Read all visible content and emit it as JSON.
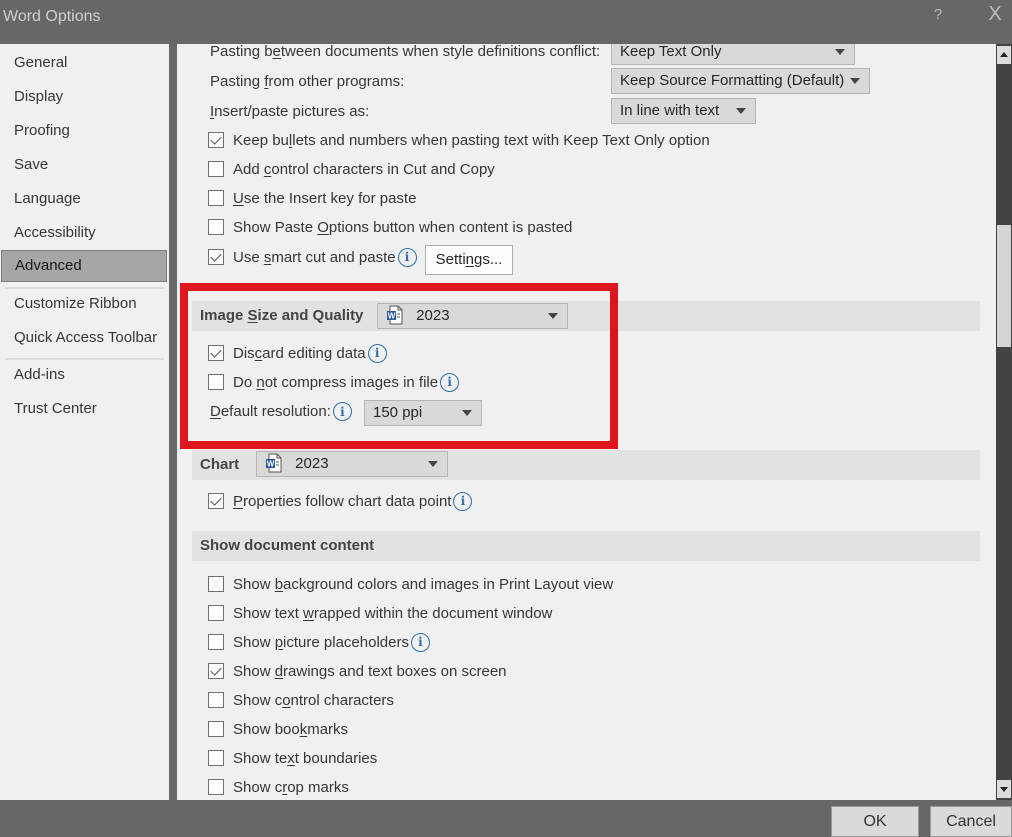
{
  "window": {
    "title": "Word Options",
    "help_label": "?",
    "close_label": "X"
  },
  "sidebar": {
    "items": [
      {
        "label": "General",
        "active": false
      },
      {
        "label": "Display",
        "active": false
      },
      {
        "label": "Proofing",
        "active": false
      },
      {
        "label": "Save",
        "active": false
      },
      {
        "label": "Language",
        "active": false
      },
      {
        "label": "Accessibility",
        "active": false
      },
      {
        "label": "Advanced",
        "active": true
      },
      {
        "label": "Customize Ribbon",
        "active": false
      },
      {
        "label": "Quick Access Toolbar",
        "active": false
      },
      {
        "label": "Add-ins",
        "active": false
      },
      {
        "label": "Trust Center",
        "active": false
      }
    ]
  },
  "paste": {
    "between_docs": {
      "label_pre": "Pasting b",
      "label_u": "e",
      "label_post": "tween documents when style definitions conflict:",
      "value": "Keep Text Only"
    },
    "other_programs": {
      "label_pre": "Pasting ",
      "label_u": "f",
      "label_post": "rom other programs:",
      "value": "Keep Source Formatting (Default)"
    },
    "pictures": {
      "label_pre": "",
      "label_u": "I",
      "label_post": "nsert/paste pictures as:",
      "value": "In line with text"
    },
    "options": [
      {
        "pre": "Keep bu",
        "u": "l",
        "post": "lets and numbers when pasting text with Keep Text Only option",
        "checked": true
      },
      {
        "pre": "Add ",
        "u": "c",
        "post": "ontrol characters in Cut and Copy",
        "checked": false
      },
      {
        "pre": "",
        "u": "U",
        "post": "se the Insert key for paste",
        "checked": false
      },
      {
        "pre": "Show Paste ",
        "u": "O",
        "post": "ptions button when content is pasted",
        "checked": false
      },
      {
        "pre": "Use ",
        "u": "s",
        "post": "mart cut and paste",
        "checked": true
      }
    ],
    "settings_button": {
      "pre": "Setti",
      "u": "n",
      "post": "gs..."
    }
  },
  "image_size": {
    "title_pre": "Image ",
    "title_u": "S",
    "title_post": "ize and Quality",
    "document": "2023",
    "options": [
      {
        "pre": "Dis",
        "u": "c",
        "post": "ard editing data",
        "checked": true
      },
      {
        "pre": "Do ",
        "u": "n",
        "post": "ot compress images in file",
        "checked": false
      }
    ],
    "resolution_label_u": "D",
    "resolution_label_post": "efault resolution:",
    "resolution_value": "150 ppi"
  },
  "chart": {
    "title": "Chart",
    "document": "2023",
    "options": [
      {
        "pre": "",
        "u": "P",
        "post": "roperties follow chart data point",
        "checked": true
      }
    ]
  },
  "show_content": {
    "title": "Show document content",
    "options": [
      {
        "pre": "Show ",
        "u": "b",
        "post": "ackground colors and images in Print Layout view",
        "checked": false
      },
      {
        "pre": "Show text ",
        "u": "w",
        "post": "rapped within the document window",
        "checked": false
      },
      {
        "pre": "Show ",
        "u": "p",
        "post": "icture placeholders",
        "checked": false
      },
      {
        "pre": "Show ",
        "u": "d",
        "post": "rawings and text boxes on screen",
        "checked": true
      },
      {
        "pre": "Show c",
        "u": "o",
        "post": "ntrol characters",
        "checked": false
      },
      {
        "pre": "Show boo",
        "u": "k",
        "post": "marks",
        "checked": false
      },
      {
        "pre": "Show te",
        "u": "x",
        "post": "t boundaries",
        "checked": false
      },
      {
        "pre": "Show c",
        "u": "r",
        "post": "op marks",
        "checked": false
      }
    ]
  },
  "footer": {
    "ok_label": "OK",
    "cancel_label": "Cancel"
  },
  "colors": {
    "highlight": "#e0161f",
    "info_icon": "#2f6eb0",
    "active_nav": "#a6a6a6"
  }
}
